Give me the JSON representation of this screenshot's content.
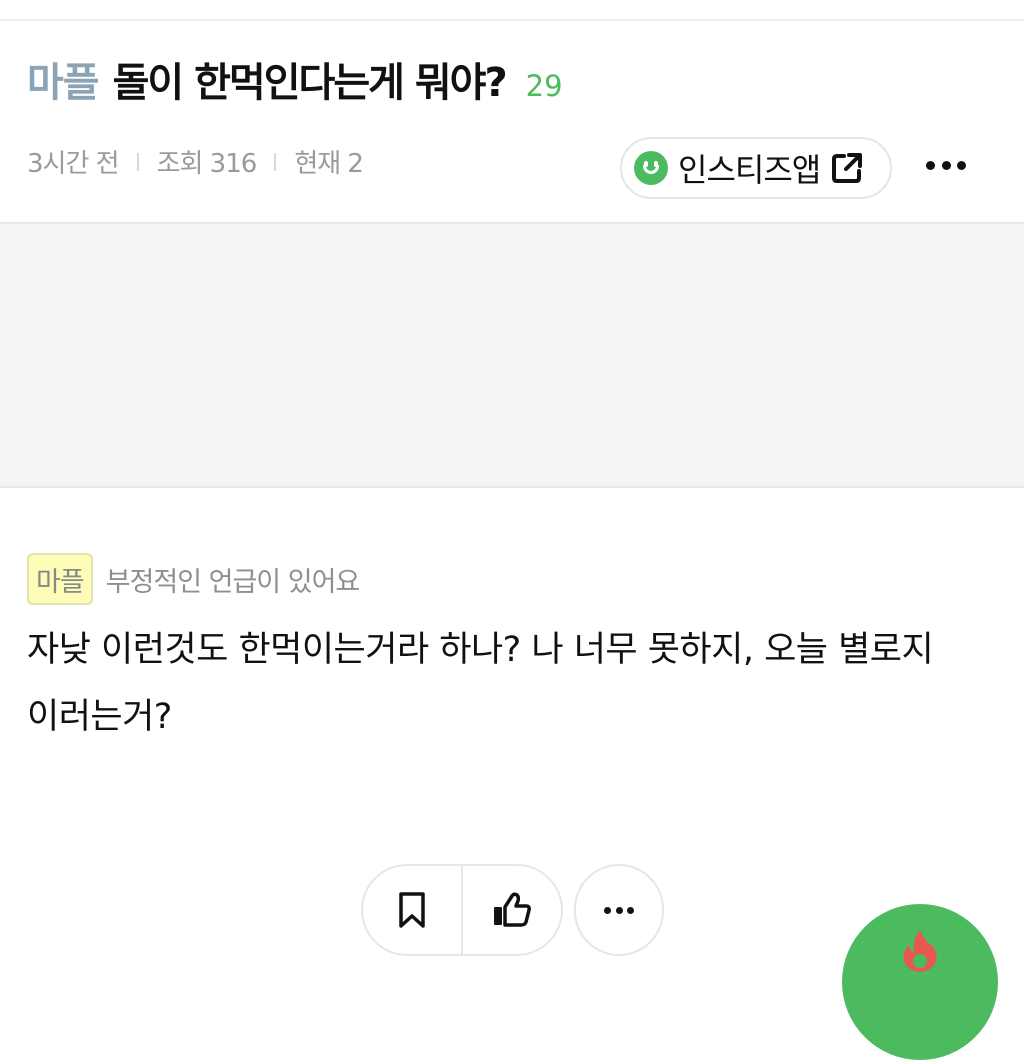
{
  "post": {
    "category": "마플",
    "title": "돌이 한먹인다는게 뭐야?",
    "comment_count": "29",
    "meta": {
      "time": "3시간 전",
      "views": "조회 316",
      "current": "현재 2"
    },
    "app_button_label": "인스티즈앱",
    "icons": {
      "app": "smile-icon",
      "external": "external-link-icon",
      "more": "more-icon"
    }
  },
  "comment": {
    "badge": "마플",
    "warning": "부정적인 언급이 있어요",
    "text": "자낮 이런것도 한먹이는거라 하나? 나 너무 못하지, 오늘 별로지 이러는거?"
  },
  "actions": {
    "icons": {
      "bookmark": "bookmark-icon",
      "like": "thumbs-up-icon",
      "more": "more-icon",
      "fab": "fire-icon"
    }
  },
  "colors": {
    "accent_green": "#4cbb5f",
    "category_blue": "#8aa3b5",
    "badge_yellow": "#fdfdb8",
    "ad_gray": "#f4f4f4",
    "fire_red": "#e8584f"
  }
}
